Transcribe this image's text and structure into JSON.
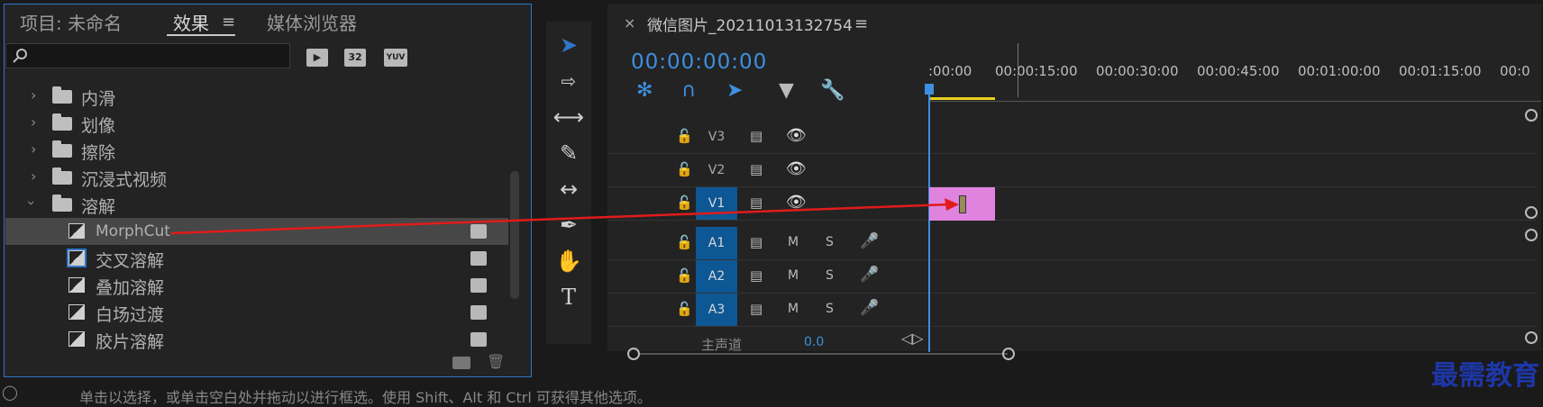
{
  "effects_panel": {
    "tabs": [
      "项目: 未命名",
      "效果",
      "媒体浏览器"
    ],
    "active_tab": "效果",
    "search": {
      "value": "",
      "placeholder": ""
    },
    "accel_icons": [
      "32",
      "YUV"
    ],
    "tree": [
      {
        "label": "内滑",
        "type": "folder",
        "expanded": false
      },
      {
        "label": "划像",
        "type": "folder",
        "expanded": false
      },
      {
        "label": "擦除",
        "type": "folder",
        "expanded": false
      },
      {
        "label": "沉浸式视频",
        "type": "folder",
        "expanded": false
      },
      {
        "label": "溶解",
        "type": "folder",
        "expanded": true
      },
      {
        "label": "MorphCut",
        "type": "effect",
        "selected": true
      },
      {
        "label": "交叉溶解",
        "type": "effect",
        "highlighted": true
      },
      {
        "label": "叠加溶解",
        "type": "effect"
      },
      {
        "label": "白场过渡",
        "type": "effect"
      },
      {
        "label": "胶片溶解",
        "type": "effect"
      }
    ]
  },
  "timeline": {
    "sequence_title": "微信图片_20211013132754",
    "timecode": "00:00:00:00",
    "ruler": [
      ":00:00",
      "00:00:15:00",
      "00:00:30:00",
      "00:00:45:00",
      "00:01:00:00",
      "00:01:15:00",
      "00:0"
    ],
    "video_tracks": [
      "V3",
      "V2",
      "V1"
    ],
    "audio_tracks": [
      "A1",
      "A2",
      "A3"
    ],
    "audio_buttons": {
      "mute": "M",
      "solo": "S"
    },
    "master": {
      "label": "主声道",
      "value": "0.0"
    }
  },
  "status_bar": "单击以选择，或单击空白处并拖动以进行框选。使用 Shift、Alt 和 Ctrl 可获得其他选项。",
  "watermark": "最需教育",
  "colors": {
    "accent": "#2f76c7",
    "clip": "#e083df",
    "arrow": "#e11b1b",
    "track_active": "#0d5795"
  }
}
